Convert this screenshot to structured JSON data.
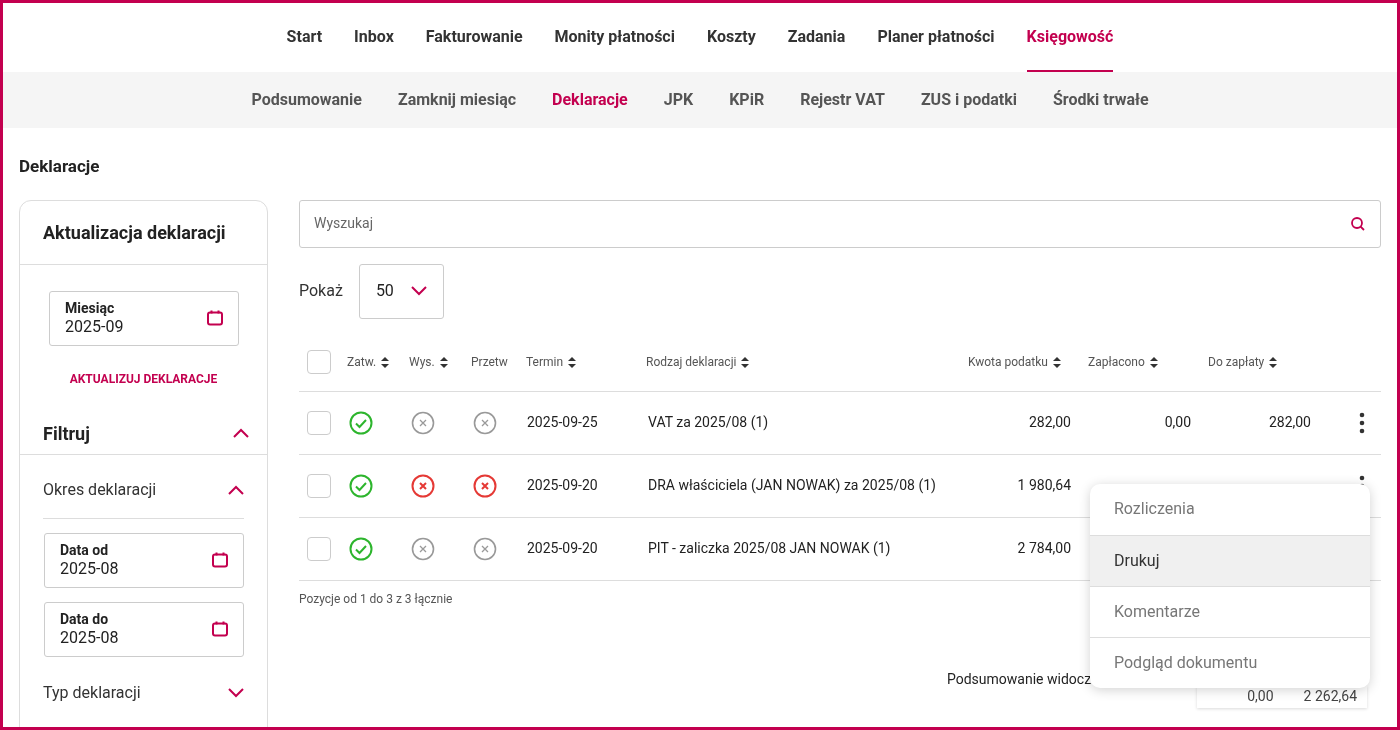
{
  "top_nav": [
    {
      "label": "Start",
      "selected": false
    },
    {
      "label": "Inbox",
      "selected": false
    },
    {
      "label": "Fakturowanie",
      "selected": false
    },
    {
      "label": "Monity płatności",
      "selected": false
    },
    {
      "label": "Koszty",
      "selected": false
    },
    {
      "label": "Zadania",
      "selected": false
    },
    {
      "label": "Planer płatności",
      "selected": false
    },
    {
      "label": "Księgowość",
      "selected": true
    }
  ],
  "sub_nav": [
    {
      "label": "Podsumowanie",
      "selected": false
    },
    {
      "label": "Zamknij miesiąc",
      "selected": false
    },
    {
      "label": "Deklaracje",
      "selected": true
    },
    {
      "label": "JPK",
      "selected": false
    },
    {
      "label": "KPiR",
      "selected": false
    },
    {
      "label": "Rejestr VAT",
      "selected": false
    },
    {
      "label": "ZUS i podatki",
      "selected": false
    },
    {
      "label": "Środki trwałe",
      "selected": false
    }
  ],
  "page_title": "Deklaracje",
  "sidebar": {
    "update_title": "Aktualizacja deklaracji",
    "month_field": {
      "label": "Miesiąc",
      "value": "2025-09"
    },
    "update_button": "AKTUALIZUJ DEKLARACJE",
    "filter": {
      "title": "Filtruj",
      "expanded": true,
      "groups": [
        {
          "title": "Okres deklaracji",
          "expanded": true,
          "fields": [
            {
              "label": "Data od",
              "value": "2025-08"
            },
            {
              "label": "Data do",
              "value": "2025-08"
            }
          ]
        },
        {
          "title": "Typ deklaracji",
          "expanded": false
        }
      ]
    }
  },
  "search": {
    "placeholder": "Wyszukaj"
  },
  "page_size": {
    "label": "Pokaż",
    "value": "50"
  },
  "table": {
    "select_all": false,
    "columns": [
      {
        "label": "Zatw.",
        "sortable": true
      },
      {
        "label": "Wys.",
        "sortable": true
      },
      {
        "label": "Przetw",
        "sortable": false
      },
      {
        "label": "Termin",
        "sortable": true
      },
      {
        "label": "Rodzaj deklaracji",
        "sortable": true
      },
      {
        "label": "Kwota podatku",
        "sortable": true
      },
      {
        "label": "Zapłacono",
        "sortable": true
      },
      {
        "label": "Do zapłaty",
        "sortable": true
      }
    ],
    "rows": [
      {
        "checked": false,
        "statuses": [
          {
            "kind": "ok"
          },
          {
            "kind": "none"
          },
          {
            "kind": "none"
          }
        ],
        "menu_open": false,
        "due": "2025-09-25",
        "type": "VAT za 2025/08 (1)",
        "tax": "282,00",
        "paid": "0,00",
        "to_pay": "282,00"
      },
      {
        "checked": false,
        "statuses": [
          {
            "kind": "ok"
          },
          {
            "kind": "error"
          },
          {
            "kind": "error"
          }
        ],
        "menu_open": true,
        "due": "2025-09-20",
        "type": "DRA właściciela (JAN NOWAK) za 2025/08 (1)",
        "tax": "1 980,64"
      },
      {
        "checked": false,
        "statuses": [
          {
            "kind": "ok"
          },
          {
            "kind": "none"
          },
          {
            "kind": "none"
          }
        ],
        "menu_open": false,
        "due": "2025-09-20",
        "type": "PIT - zaliczka 2025/08 JAN NOWAK (1)",
        "tax": "2 784,00"
      }
    ],
    "footer": "Pozycje od 1 do 3 z 3 łącznie"
  },
  "summary": {
    "label": "Podsumowanie widocz",
    "paid": "0,00",
    "to_pay": "2 262,64"
  },
  "context_menu": [
    {
      "label": "Rozliczenia",
      "selected": false
    },
    {
      "label": "Drukuj",
      "selected": true
    },
    {
      "label": "Komentarze",
      "selected": false
    },
    {
      "label": "Podgląd dokumentu",
      "selected": false
    }
  ]
}
